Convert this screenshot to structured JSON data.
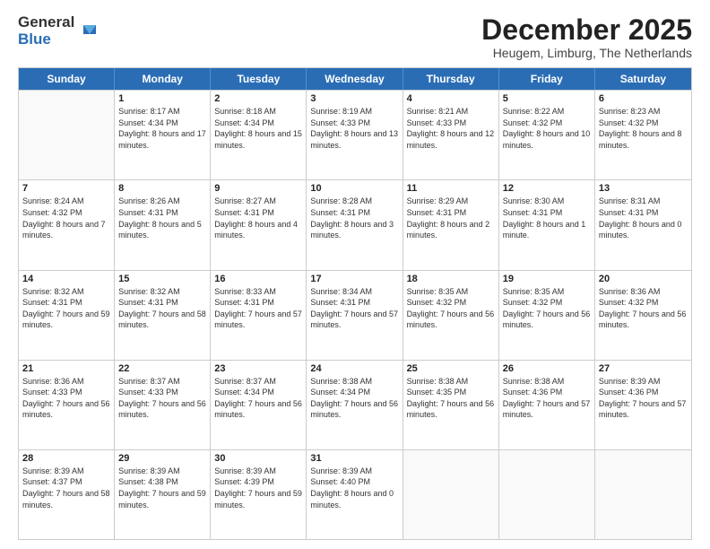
{
  "logo": {
    "general": "General",
    "blue": "Blue"
  },
  "header": {
    "month": "December 2025",
    "location": "Heugem, Limburg, The Netherlands"
  },
  "days": [
    "Sunday",
    "Monday",
    "Tuesday",
    "Wednesday",
    "Thursday",
    "Friday",
    "Saturday"
  ],
  "weeks": [
    [
      {
        "day": "",
        "empty": true
      },
      {
        "day": "1",
        "sunrise": "Sunrise: 8:17 AM",
        "sunset": "Sunset: 4:34 PM",
        "daylight": "Daylight: 8 hours and 17 minutes."
      },
      {
        "day": "2",
        "sunrise": "Sunrise: 8:18 AM",
        "sunset": "Sunset: 4:34 PM",
        "daylight": "Daylight: 8 hours and 15 minutes."
      },
      {
        "day": "3",
        "sunrise": "Sunrise: 8:19 AM",
        "sunset": "Sunset: 4:33 PM",
        "daylight": "Daylight: 8 hours and 13 minutes."
      },
      {
        "day": "4",
        "sunrise": "Sunrise: 8:21 AM",
        "sunset": "Sunset: 4:33 PM",
        "daylight": "Daylight: 8 hours and 12 minutes."
      },
      {
        "day": "5",
        "sunrise": "Sunrise: 8:22 AM",
        "sunset": "Sunset: 4:32 PM",
        "daylight": "Daylight: 8 hours and 10 minutes."
      },
      {
        "day": "6",
        "sunrise": "Sunrise: 8:23 AM",
        "sunset": "Sunset: 4:32 PM",
        "daylight": "Daylight: 8 hours and 8 minutes."
      }
    ],
    [
      {
        "day": "7",
        "sunrise": "Sunrise: 8:24 AM",
        "sunset": "Sunset: 4:32 PM",
        "daylight": "Daylight: 8 hours and 7 minutes."
      },
      {
        "day": "8",
        "sunrise": "Sunrise: 8:26 AM",
        "sunset": "Sunset: 4:31 PM",
        "daylight": "Daylight: 8 hours and 5 minutes."
      },
      {
        "day": "9",
        "sunrise": "Sunrise: 8:27 AM",
        "sunset": "Sunset: 4:31 PM",
        "daylight": "Daylight: 8 hours and 4 minutes."
      },
      {
        "day": "10",
        "sunrise": "Sunrise: 8:28 AM",
        "sunset": "Sunset: 4:31 PM",
        "daylight": "Daylight: 8 hours and 3 minutes."
      },
      {
        "day": "11",
        "sunrise": "Sunrise: 8:29 AM",
        "sunset": "Sunset: 4:31 PM",
        "daylight": "Daylight: 8 hours and 2 minutes."
      },
      {
        "day": "12",
        "sunrise": "Sunrise: 8:30 AM",
        "sunset": "Sunset: 4:31 PM",
        "daylight": "Daylight: 8 hours and 1 minute."
      },
      {
        "day": "13",
        "sunrise": "Sunrise: 8:31 AM",
        "sunset": "Sunset: 4:31 PM",
        "daylight": "Daylight: 8 hours and 0 minutes."
      }
    ],
    [
      {
        "day": "14",
        "sunrise": "Sunrise: 8:32 AM",
        "sunset": "Sunset: 4:31 PM",
        "daylight": "Daylight: 7 hours and 59 minutes."
      },
      {
        "day": "15",
        "sunrise": "Sunrise: 8:32 AM",
        "sunset": "Sunset: 4:31 PM",
        "daylight": "Daylight: 7 hours and 58 minutes."
      },
      {
        "day": "16",
        "sunrise": "Sunrise: 8:33 AM",
        "sunset": "Sunset: 4:31 PM",
        "daylight": "Daylight: 7 hours and 57 minutes."
      },
      {
        "day": "17",
        "sunrise": "Sunrise: 8:34 AM",
        "sunset": "Sunset: 4:31 PM",
        "daylight": "Daylight: 7 hours and 57 minutes."
      },
      {
        "day": "18",
        "sunrise": "Sunrise: 8:35 AM",
        "sunset": "Sunset: 4:32 PM",
        "daylight": "Daylight: 7 hours and 56 minutes."
      },
      {
        "day": "19",
        "sunrise": "Sunrise: 8:35 AM",
        "sunset": "Sunset: 4:32 PM",
        "daylight": "Daylight: 7 hours and 56 minutes."
      },
      {
        "day": "20",
        "sunrise": "Sunrise: 8:36 AM",
        "sunset": "Sunset: 4:32 PM",
        "daylight": "Daylight: 7 hours and 56 minutes."
      }
    ],
    [
      {
        "day": "21",
        "sunrise": "Sunrise: 8:36 AM",
        "sunset": "Sunset: 4:33 PM",
        "daylight": "Daylight: 7 hours and 56 minutes."
      },
      {
        "day": "22",
        "sunrise": "Sunrise: 8:37 AM",
        "sunset": "Sunset: 4:33 PM",
        "daylight": "Daylight: 7 hours and 56 minutes."
      },
      {
        "day": "23",
        "sunrise": "Sunrise: 8:37 AM",
        "sunset": "Sunset: 4:34 PM",
        "daylight": "Daylight: 7 hours and 56 minutes."
      },
      {
        "day": "24",
        "sunrise": "Sunrise: 8:38 AM",
        "sunset": "Sunset: 4:34 PM",
        "daylight": "Daylight: 7 hours and 56 minutes."
      },
      {
        "day": "25",
        "sunrise": "Sunrise: 8:38 AM",
        "sunset": "Sunset: 4:35 PM",
        "daylight": "Daylight: 7 hours and 56 minutes."
      },
      {
        "day": "26",
        "sunrise": "Sunrise: 8:38 AM",
        "sunset": "Sunset: 4:36 PM",
        "daylight": "Daylight: 7 hours and 57 minutes."
      },
      {
        "day": "27",
        "sunrise": "Sunrise: 8:39 AM",
        "sunset": "Sunset: 4:36 PM",
        "daylight": "Daylight: 7 hours and 57 minutes."
      }
    ],
    [
      {
        "day": "28",
        "sunrise": "Sunrise: 8:39 AM",
        "sunset": "Sunset: 4:37 PM",
        "daylight": "Daylight: 7 hours and 58 minutes."
      },
      {
        "day": "29",
        "sunrise": "Sunrise: 8:39 AM",
        "sunset": "Sunset: 4:38 PM",
        "daylight": "Daylight: 7 hours and 59 minutes."
      },
      {
        "day": "30",
        "sunrise": "Sunrise: 8:39 AM",
        "sunset": "Sunset: 4:39 PM",
        "daylight": "Daylight: 7 hours and 59 minutes."
      },
      {
        "day": "31",
        "sunrise": "Sunrise: 8:39 AM",
        "sunset": "Sunset: 4:40 PM",
        "daylight": "Daylight: 8 hours and 0 minutes."
      },
      {
        "day": "",
        "empty": true
      },
      {
        "day": "",
        "empty": true
      },
      {
        "day": "",
        "empty": true
      }
    ]
  ]
}
